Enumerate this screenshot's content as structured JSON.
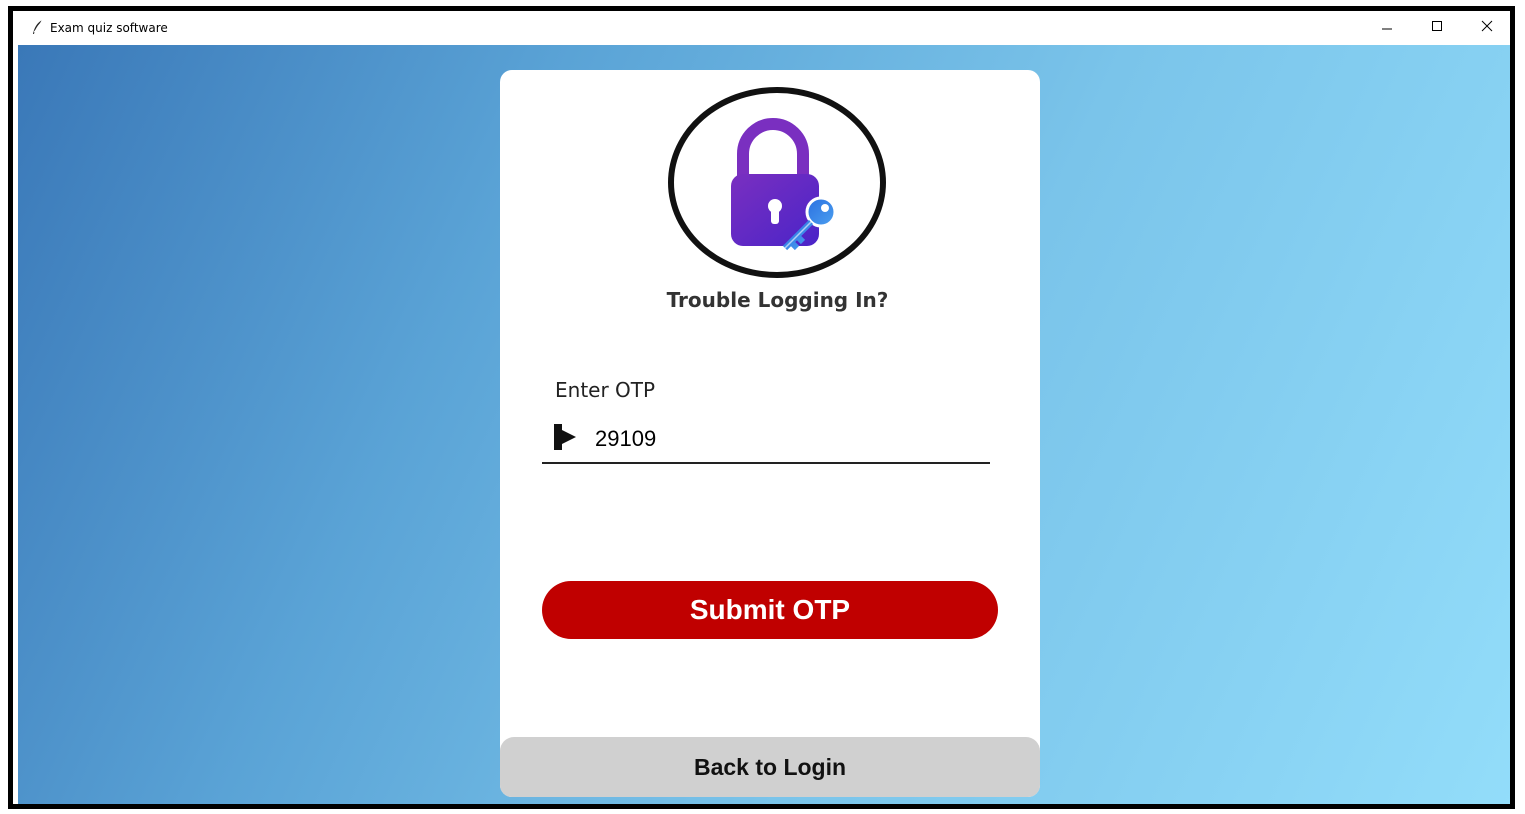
{
  "window": {
    "title": "Exam quiz software",
    "icon": "feather-icon",
    "controls": [
      "minimize-icon",
      "maximize-icon",
      "close-icon"
    ]
  },
  "card": {
    "icon": "lock-key-icon",
    "heading": "Trouble Logging In?",
    "otp": {
      "label": "Enter OTP",
      "icon": "arrow-into-bar-icon",
      "value": "29109"
    },
    "submit_label": "Submit OTP",
    "back_label": "Back to Login"
  },
  "colors": {
    "submit_button": "#c00000",
    "back_button": "#d0d0d0",
    "lock_body": "#6a28c8",
    "key": "#3d7fe0",
    "background_start": "#3a78b8",
    "background_end": "#93ddfa"
  }
}
